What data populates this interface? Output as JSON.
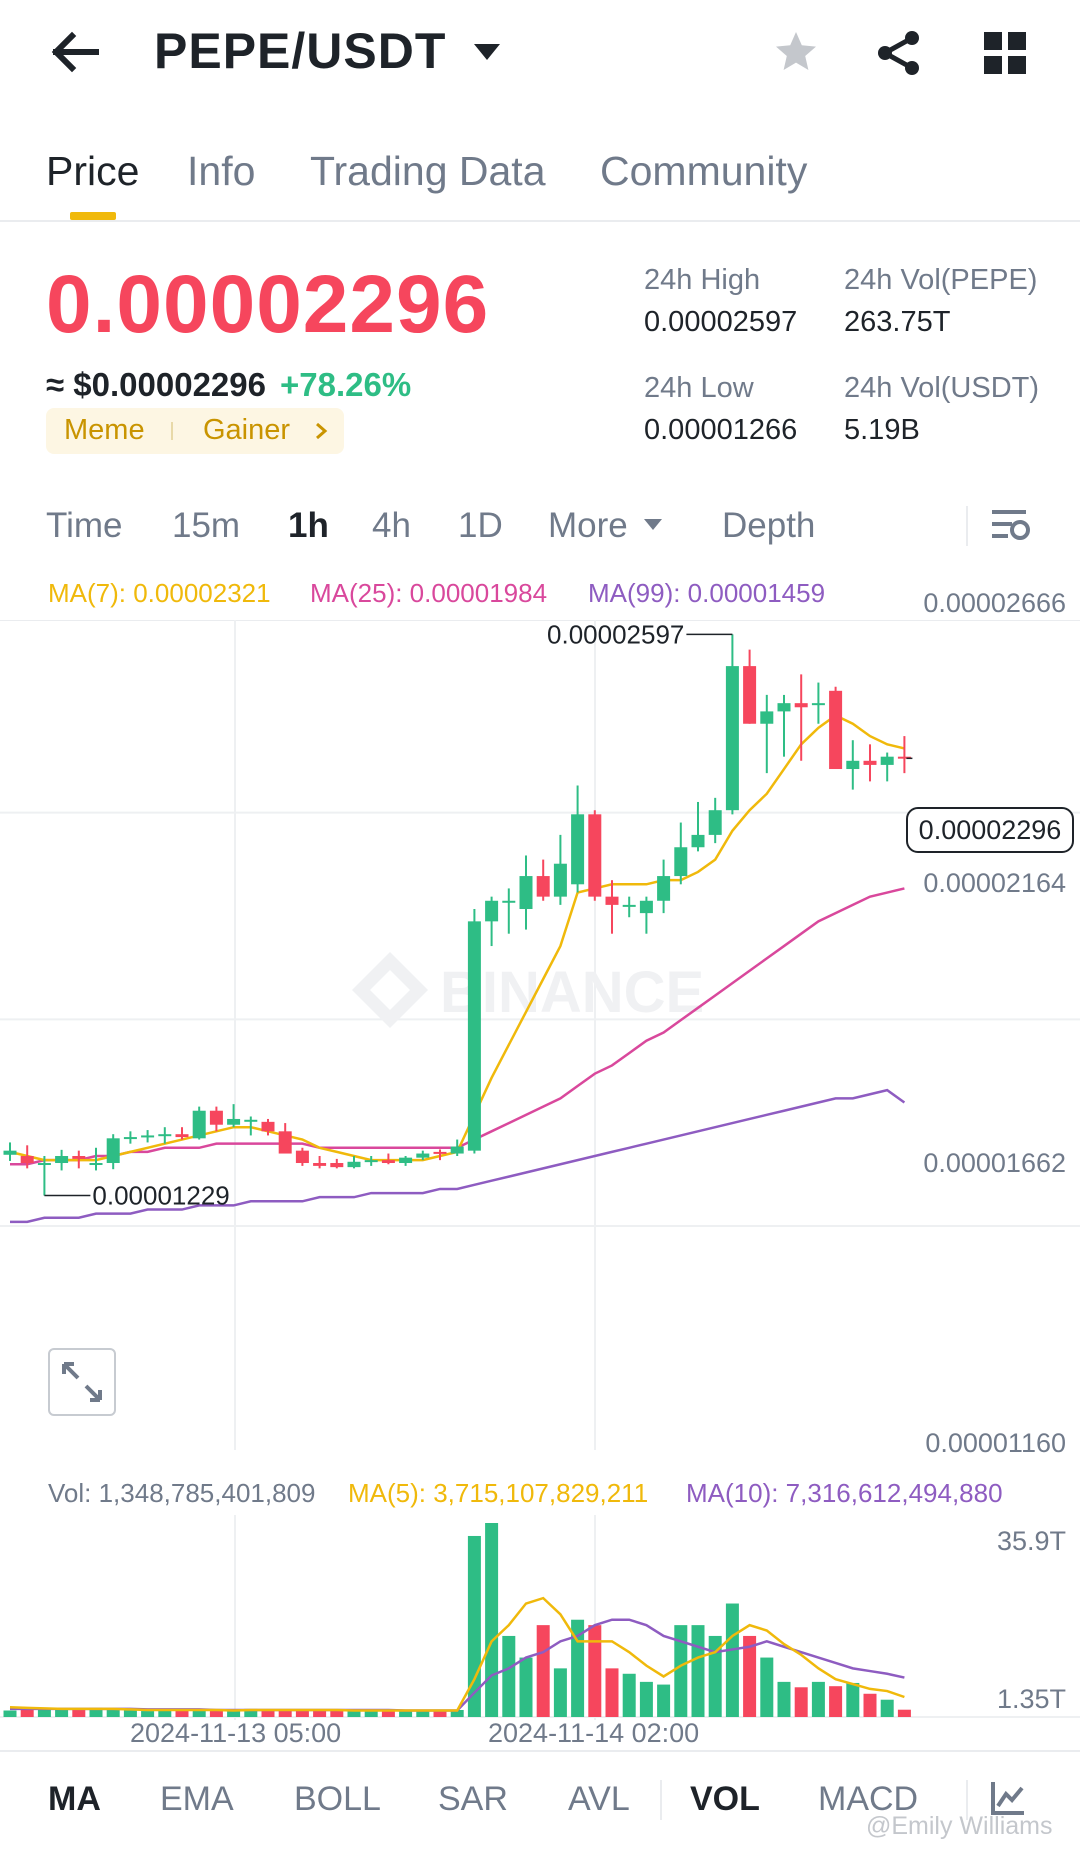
{
  "header": {
    "pair": "PEPE/USDT"
  },
  "tabs": [
    "Price",
    "Info",
    "Trading Data",
    "Community"
  ],
  "price": {
    "last": "0.00002296",
    "usd": "≈ $0.00002296",
    "change": "+78.26%",
    "tags": [
      "Meme",
      "Gainer"
    ]
  },
  "stats": {
    "high_label": "24h High",
    "high": "0.00002597",
    "low_label": "24h Low",
    "low": "0.00001266",
    "vol_base_label": "24h Vol(PEPE)",
    "vol_base": "263.75T",
    "vol_quote_label": "24h Vol(USDT)",
    "vol_quote": "5.19B"
  },
  "intervals": [
    "Time",
    "15m",
    "1h",
    "4h",
    "1D",
    "More",
    "Depth"
  ],
  "selected_interval": "1h",
  "ma_legend": {
    "ma7": "MA(7): 0.00002321",
    "ma25": "MA(25): 0.00001984",
    "ma99": "MA(99): 0.00001459"
  },
  "price_axis": [
    "0.00002666",
    "0.00002164",
    "0.00001662",
    "0.00001160"
  ],
  "annotations": {
    "high": "0.00002597",
    "low": "0.00001229",
    "current": "0.00002296"
  },
  "vol_legend": {
    "vol": "Vol: 1,348,785,401,809",
    "ma5": "MA(5): 3,715,107,829,211",
    "ma10": "MA(10): 7,316,612,494,880"
  },
  "vol_axis": [
    "35.9T",
    "1.35T"
  ],
  "dates": [
    "2024-11-13 05:00",
    "2024-11-14 02:00"
  ],
  "watermark": "BINANCE",
  "indicators": [
    "MA",
    "EMA",
    "BOLL",
    "SAR",
    "AVL",
    "VOL",
    "MACD"
  ],
  "active_indicators": [
    "MA",
    "VOL"
  ],
  "credit": "@Emily Williams",
  "colors": {
    "up": "#2ebd85",
    "down": "#f6465d",
    "ma7": "#f0b90b",
    "ma25": "#d9489c",
    "ma99": "#8e5cc1",
    "accent": "#f0b90b"
  },
  "chart_data": {
    "type": "candlestick",
    "pair": "PEPE/USDT",
    "interval": "1h",
    "ylim": [
      1.16e-05,
      2.666e-05
    ],
    "candles": [
      {
        "o": 1.333,
        "h": 1.363,
        "l": 1.318,
        "c": 1.343
      },
      {
        "o": 1.33,
        "h": 1.356,
        "l": 1.3,
        "c": 1.313
      },
      {
        "o": 1.313,
        "h": 1.33,
        "l": 1.234,
        "c": 1.313
      },
      {
        "o": 1.313,
        "h": 1.345,
        "l": 1.295,
        "c": 1.33
      },
      {
        "o": 1.33,
        "h": 1.343,
        "l": 1.3,
        "c": 1.323
      },
      {
        "o": 1.313,
        "h": 1.35,
        "l": 1.295,
        "c": 1.313
      },
      {
        "o": 1.313,
        "h": 1.383,
        "l": 1.298,
        "c": 1.373
      },
      {
        "o": 1.373,
        "h": 1.39,
        "l": 1.36,
        "c": 1.376
      },
      {
        "o": 1.376,
        "h": 1.393,
        "l": 1.363,
        "c": 1.38
      },
      {
        "o": 1.38,
        "h": 1.4,
        "l": 1.36,
        "c": 1.383
      },
      {
        "o": 1.383,
        "h": 1.4,
        "l": 1.37,
        "c": 1.376
      },
      {
        "o": 1.373,
        "h": 1.45,
        "l": 1.37,
        "c": 1.44
      },
      {
        "o": 1.44,
        "h": 1.45,
        "l": 1.39,
        "c": 1.406
      },
      {
        "o": 1.406,
        "h": 1.456,
        "l": 1.4,
        "c": 1.42
      },
      {
        "o": 1.416,
        "h": 1.426,
        "l": 1.38,
        "c": 1.418
      },
      {
        "o": 1.413,
        "h": 1.42,
        "l": 1.38,
        "c": 1.39
      },
      {
        "o": 1.39,
        "h": 1.41,
        "l": 1.36,
        "c": 1.336
      },
      {
        "o": 1.343,
        "h": 1.35,
        "l": 1.306,
        "c": 1.313
      },
      {
        "o": 1.313,
        "h": 1.33,
        "l": 1.3,
        "c": 1.306
      },
      {
        "o": 1.313,
        "h": 1.323,
        "l": 1.3,
        "c": 1.303
      },
      {
        "o": 1.303,
        "h": 1.33,
        "l": 1.3,
        "c": 1.316
      },
      {
        "o": 1.316,
        "h": 1.33,
        "l": 1.306,
        "c": 1.32
      },
      {
        "o": 1.32,
        "h": 1.336,
        "l": 1.31,
        "c": 1.313
      },
      {
        "o": 1.313,
        "h": 1.33,
        "l": 1.306,
        "c": 1.326
      },
      {
        "o": 1.326,
        "h": 1.343,
        "l": 1.32,
        "c": 1.336
      },
      {
        "o": 1.34,
        "h": 1.346,
        "l": 1.32,
        "c": 1.336
      },
      {
        "o": 1.336,
        "h": 1.37,
        "l": 1.33,
        "c": 1.353
      },
      {
        "o": 1.343,
        "h": 1.93,
        "l": 1.336,
        "c": 1.9
      },
      {
        "o": 1.9,
        "h": 1.96,
        "l": 1.84,
        "c": 1.95
      },
      {
        "o": 1.95,
        "h": 1.98,
        "l": 1.87,
        "c": 1.95
      },
      {
        "o": 1.93,
        "h": 2.06,
        "l": 1.88,
        "c": 2.01
      },
      {
        "o": 2.01,
        "h": 2.05,
        "l": 1.95,
        "c": 1.96
      },
      {
        "o": 1.96,
        "h": 2.11,
        "l": 1.94,
        "c": 2.04
      },
      {
        "o": 1.99,
        "h": 2.23,
        "l": 1.97,
        "c": 2.16
      },
      {
        "o": 2.16,
        "h": 2.17,
        "l": 1.95,
        "c": 1.96
      },
      {
        "o": 1.96,
        "h": 2.0,
        "l": 1.87,
        "c": 1.94
      },
      {
        "o": 1.94,
        "h": 1.96,
        "l": 1.91,
        "c": 1.94
      },
      {
        "o": 1.92,
        "h": 1.96,
        "l": 1.87,
        "c": 1.95
      },
      {
        "o": 1.95,
        "h": 2.05,
        "l": 1.92,
        "c": 2.01
      },
      {
        "o": 2.01,
        "h": 2.14,
        "l": 1.99,
        "c": 2.08
      },
      {
        "o": 2.08,
        "h": 2.19,
        "l": 2.07,
        "c": 2.11
      },
      {
        "o": 2.11,
        "h": 2.2,
        "l": 2.09,
        "c": 2.17
      },
      {
        "o": 2.17,
        "h": 2.597,
        "l": 2.16,
        "c": 2.52
      },
      {
        "o": 2.52,
        "h": 2.56,
        "l": 2.38,
        "c": 2.38
      },
      {
        "o": 2.38,
        "h": 2.45,
        "l": 2.26,
        "c": 2.41
      },
      {
        "o": 2.41,
        "h": 2.45,
        "l": 2.3,
        "c": 2.43
      },
      {
        "o": 2.43,
        "h": 2.5,
        "l": 2.29,
        "c": 2.42
      },
      {
        "o": 2.43,
        "h": 2.48,
        "l": 2.38,
        "c": 2.43
      },
      {
        "o": 2.46,
        "h": 2.47,
        "l": 2.27,
        "c": 2.27
      },
      {
        "o": 2.27,
        "h": 2.34,
        "l": 2.22,
        "c": 2.29
      },
      {
        "o": 2.29,
        "h": 2.33,
        "l": 2.24,
        "c": 2.28
      },
      {
        "o": 2.28,
        "h": 2.31,
        "l": 2.24,
        "c": 2.3
      },
      {
        "o": 2.3,
        "h": 2.35,
        "l": 2.26,
        "c": 2.296
      }
    ],
    "candle_scale": 1e-05,
    "ma7": [
      1.34,
      1.33,
      1.32,
      1.32,
      1.32,
      1.32,
      1.33,
      1.34,
      1.35,
      1.36,
      1.37,
      1.38,
      1.39,
      1.4,
      1.4,
      1.39,
      1.38,
      1.37,
      1.35,
      1.34,
      1.33,
      1.32,
      1.32,
      1.32,
      1.32,
      1.33,
      1.34,
      1.43,
      1.52,
      1.6,
      1.68,
      1.76,
      1.84,
      1.97,
      1.98,
      1.99,
      1.99,
      1.99,
      2.0,
      2.0,
      2.02,
      2.05,
      2.12,
      2.17,
      2.21,
      2.27,
      2.33,
      2.37,
      2.4,
      2.38,
      2.35,
      2.33,
      2.32
    ],
    "ma25": [
      1.31,
      1.31,
      1.32,
      1.32,
      1.32,
      1.33,
      1.33,
      1.34,
      1.34,
      1.35,
      1.35,
      1.35,
      1.36,
      1.36,
      1.36,
      1.36,
      1.36,
      1.36,
      1.35,
      1.35,
      1.35,
      1.35,
      1.35,
      1.35,
      1.35,
      1.35,
      1.35,
      1.37,
      1.39,
      1.41,
      1.43,
      1.45,
      1.47,
      1.5,
      1.53,
      1.55,
      1.58,
      1.61,
      1.63,
      1.66,
      1.69,
      1.72,
      1.75,
      1.78,
      1.81,
      1.84,
      1.87,
      1.9,
      1.92,
      1.94,
      1.96,
      1.97,
      1.98
    ],
    "ma99": [
      1.17,
      1.17,
      1.18,
      1.18,
      1.18,
      1.19,
      1.19,
      1.19,
      1.2,
      1.2,
      1.2,
      1.21,
      1.21,
      1.21,
      1.22,
      1.22,
      1.22,
      1.22,
      1.23,
      1.23,
      1.23,
      1.24,
      1.24,
      1.24,
      1.24,
      1.25,
      1.25,
      1.26,
      1.27,
      1.28,
      1.29,
      1.3,
      1.31,
      1.32,
      1.33,
      1.34,
      1.35,
      1.36,
      1.37,
      1.38,
      1.39,
      1.4,
      1.41,
      1.42,
      1.43,
      1.44,
      1.45,
      1.46,
      1.47,
      1.47,
      1.48,
      1.49,
      1.46
    ],
    "volume": [
      1.2,
      1.6,
      1.4,
      1.5,
      1.6,
      1.7,
      1.4,
      1.2,
      1.1,
      1.3,
      1.2,
      1.4,
      1.2,
      1.1,
      1.5,
      1.4,
      1.3,
      1.2,
      1.2,
      1.2,
      1.2,
      1.1,
      1.2,
      1.2,
      1.2,
      1.2,
      1.3,
      33.5,
      35.9,
      15,
      11,
      17,
      9,
      18,
      17,
      9,
      8,
      6.5,
      6,
      17,
      17,
      15,
      21,
      15,
      11,
      6.5,
      5.5,
      6.5,
      5.7,
      6.3,
      4.3,
      3.2,
      1.35
    ],
    "volume_unit": "T",
    "vol_ma5": [
      1.8,
      1.7,
      1.6,
      1.5,
      1.5,
      1.5,
      1.5,
      1.4,
      1.3,
      1.3,
      1.3,
      1.3,
      1.3,
      1.2,
      1.3,
      1.3,
      1.3,
      1.3,
      1.3,
      1.3,
      1.2,
      1.2,
      1.2,
      1.2,
      1.2,
      1.2,
      1.2,
      7,
      14,
      17,
      21,
      22,
      19,
      14,
      14,
      14,
      12,
      9.5,
      7.5,
      9.5,
      11,
      12,
      15,
      17,
      16,
      13.5,
      11.5,
      9,
      7,
      6.1,
      5.2,
      4.8,
      3.7
    ],
    "vol_ma10": [
      1.5,
      1.5,
      1.5,
      1.5,
      1.5,
      1.5,
      1.5,
      1.5,
      1.4,
      1.4,
      1.4,
      1.4,
      1.3,
      1.3,
      1.3,
      1.3,
      1.3,
      1.3,
      1.3,
      1.3,
      1.3,
      1.3,
      1.3,
      1.2,
      1.2,
      1.2,
      1.2,
      4.5,
      7.7,
      9,
      11,
      12,
      14,
      15,
      17,
      18,
      18,
      17,
      15,
      14,
      13,
      12,
      12.5,
      13,
      14,
      13,
      12,
      11,
      10,
      9,
      8.5,
      8,
      7.3
    ],
    "volume_ylim": [
      0,
      35.9
    ]
  }
}
